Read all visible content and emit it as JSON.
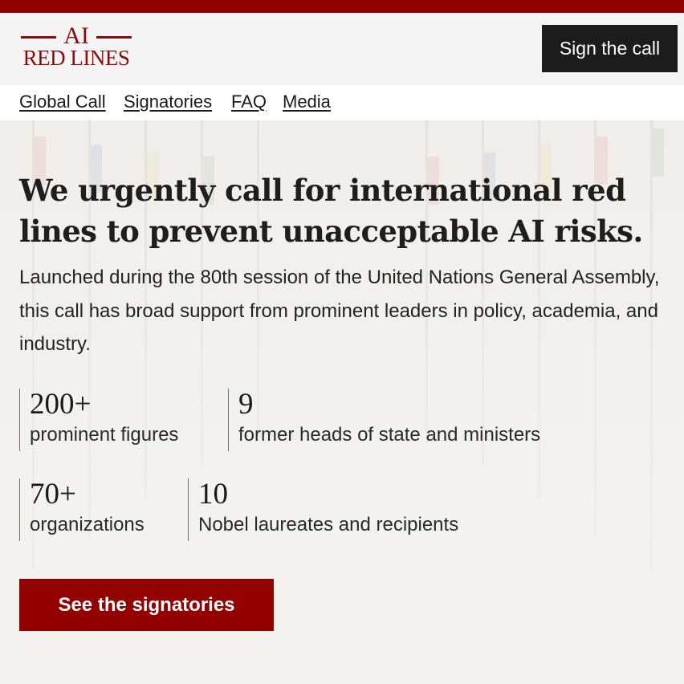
{
  "colors": {
    "brand_red": "#8f0000",
    "dark_button": "#1c1c1c",
    "text": "#1e1e1e"
  },
  "logo": {
    "top_text": "AI",
    "bottom_text": "RED LINES"
  },
  "header": {
    "sign_button_label": "Sign the call"
  },
  "nav": {
    "items": [
      {
        "label": "Global Call"
      },
      {
        "label": "Signatories"
      },
      {
        "label": "FAQ"
      },
      {
        "label": "Media"
      }
    ]
  },
  "hero": {
    "headline": "We urgently call for international red lines to prevent unacceptable AI risks.",
    "lead": "Launched during the 80th session of the United Nations General Assembly, this call has broad support from prominent leaders in policy, academia, and industry.",
    "stats": [
      {
        "number": "200+",
        "label": "prominent figures"
      },
      {
        "number": "9",
        "label": "former heads of state and ministers"
      },
      {
        "number": "70+",
        "label": "organizations"
      },
      {
        "number": "10",
        "label": "Nobel laureates and recipients"
      }
    ],
    "cta_label": "See the signatories"
  }
}
